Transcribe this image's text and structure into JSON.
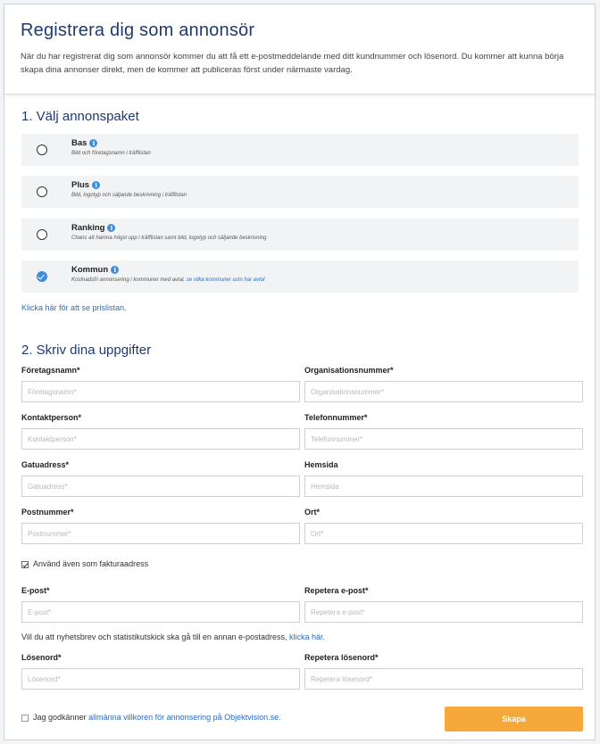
{
  "header": {
    "title": "Registrera dig som annonsör",
    "intro": "När du har registrerat dig som annonsör kommer du att få ett e-postmeddelande med ditt kundnummer och lösenord. Du kommer att kunna börja skapa dina annonser direkt, men de kommer att publiceras först under närmaste vardag."
  },
  "packages": {
    "title": "1. Välj annonspaket",
    "items": [
      {
        "name": "Bas",
        "description": "Bild och företagsnamn i träfflistan",
        "selected": false
      },
      {
        "name": "Plus",
        "description": "Bild, logotyp och säljande beskrivning i träfflistan",
        "selected": false
      },
      {
        "name": "Ranking",
        "description": "Chans att hamna högst upp i träfflistan samt bild, logotyp och säljande beskrivning",
        "selected": false
      },
      {
        "name": "Kommun",
        "description": "Kostnadsfri annonsering i kommuner med avtal,",
        "link_text": "se vilka kommuner som har avtal",
        "selected": true
      }
    ],
    "price_link": "Klicka här för att se prislistan."
  },
  "details": {
    "title": "2. Skriv dina uppgifter",
    "fields": {
      "company": {
        "label": "Företagsnamn*",
        "placeholder": "Företagsnamn*",
        "value": ""
      },
      "orgnr": {
        "label": "Organisationsnummer*",
        "placeholder": "Organisationsnummer*",
        "value": ""
      },
      "contact": {
        "label": "Kontaktperson*",
        "placeholder": "Kontaktperson*",
        "value": ""
      },
      "phone": {
        "label": "Telefonnummer*",
        "placeholder": "Telefonnummer*",
        "value": ""
      },
      "street": {
        "label": "Gatuadress*",
        "placeholder": "Gatuadress*",
        "value": ""
      },
      "website": {
        "label": "Hemsida",
        "placeholder": "Hemsida",
        "value": ""
      },
      "zip": {
        "label": "Postnummer*",
        "placeholder": "Postnummer*",
        "value": ""
      },
      "city": {
        "label": "Ort*",
        "placeholder": "Ort*",
        "value": ""
      },
      "email": {
        "label": "E-post*",
        "placeholder": "E-post*",
        "value": ""
      },
      "email_repeat": {
        "label": "Repetera e-post*",
        "placeholder": "Repetera e-post*",
        "value": ""
      },
      "password": {
        "label": "Lösenord*",
        "placeholder": "Lösenord*",
        "value": ""
      },
      "password_repeat": {
        "label": "Repetera lösenord*",
        "placeholder": "Repetera lösenord*",
        "value": ""
      }
    },
    "invoice_checkbox": {
      "label": "Använd även som fakturaadress",
      "checked": true
    },
    "newsletter_text": "Vill du att nyhetsbrev och statistikutskick ska gå till en annan e-postadress,",
    "newsletter_link": "klicka här.",
    "terms": {
      "prefix": "Jag godkänner",
      "link": "allmänna villkoren för annonsering på Objektvision.se.",
      "checked": false
    },
    "submit_label": "Skapa"
  },
  "colors": {
    "heading": "#1e3a6e",
    "link": "#2a6cc2",
    "accent": "#3d8ce0",
    "submit": "#f6a83a"
  }
}
